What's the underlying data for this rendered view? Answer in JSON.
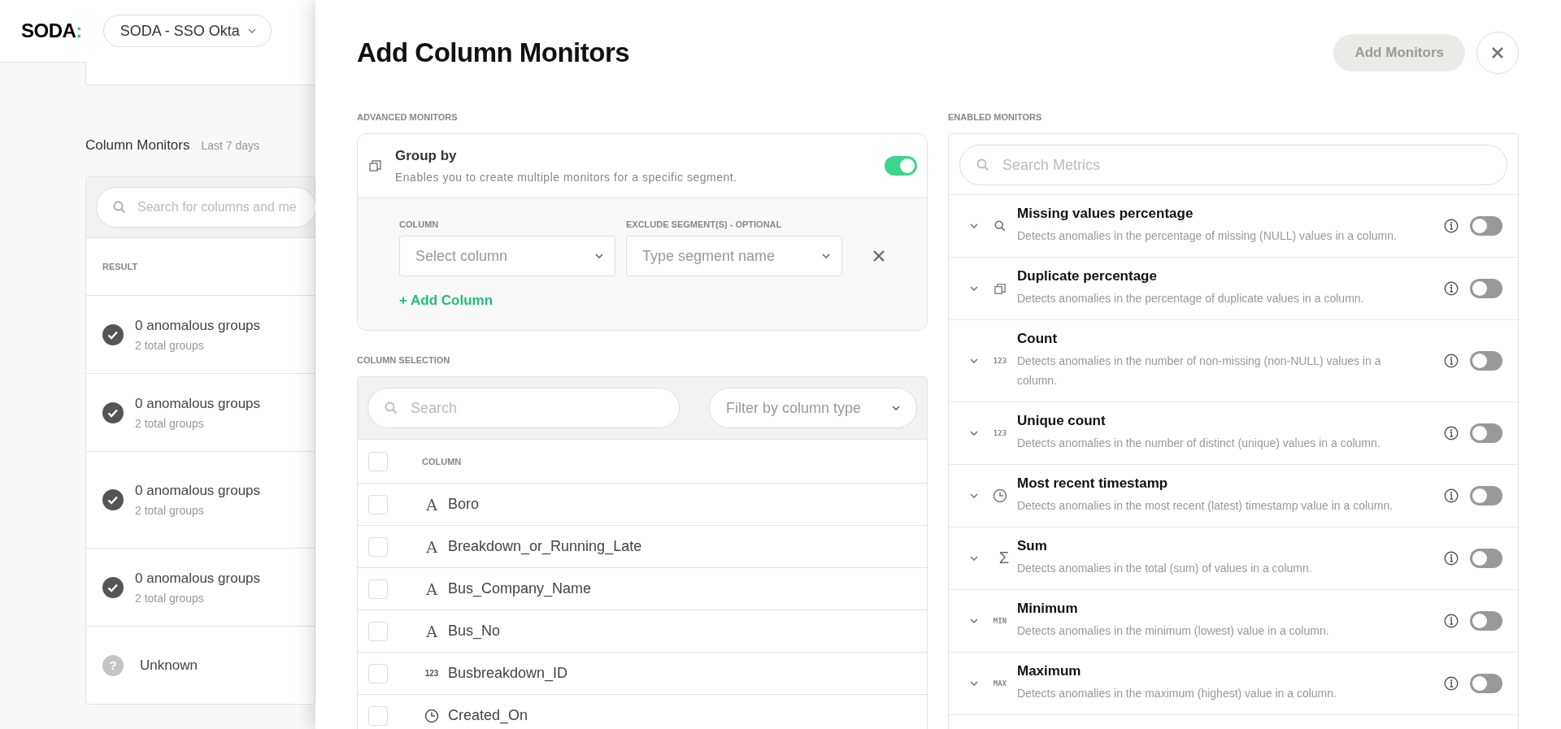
{
  "header": {
    "logo": "SODA",
    "logo_mark": ":",
    "org": "SODA - SSO Okta"
  },
  "background": {
    "section_title": "Column Monitors",
    "section_period": "Last 7 days",
    "search": {
      "placeholder": "Search for columns and me"
    },
    "column_header": "RESULT",
    "rows": [
      {
        "kind": "ok",
        "title": "0 anomalous groups",
        "subtitle": "2 total groups"
      },
      {
        "kind": "ok",
        "title": "0 anomalous groups",
        "subtitle": "2 total groups"
      },
      {
        "kind": "ok",
        "title": "0 anomalous groups",
        "subtitle": "2 total groups"
      },
      {
        "kind": "ok",
        "title": "0 anomalous groups",
        "subtitle": "2 total groups"
      },
      {
        "kind": "unknown",
        "status_glyph": "?",
        "title": "Unknown"
      }
    ]
  },
  "modal": {
    "title": "Add Column Monitors",
    "primary_button": {
      "label": "Add Monitors",
      "disabled": true
    },
    "advanced": {
      "heading": "ADVANCED MONITORS",
      "group_by": {
        "title": "Group by",
        "description": "Enables you to create multiple monitors for a specific segment.",
        "on": true,
        "column_label": "COLUMN",
        "column_select": {
          "placeholder": "Select column"
        },
        "exclude_label": "EXCLUDE SEGMENT(S) - OPTIONAL",
        "exclude_select": {
          "placeholder": "Type segment name"
        },
        "add_link": "+ Add Column"
      }
    },
    "column_selection": {
      "heading": "COLUMN SELECTION",
      "search": {
        "placeholder": "Search"
      },
      "filter": {
        "placeholder": "Filter by column type"
      },
      "column_header": "COLUMN",
      "all_checked": false,
      "rows": [
        {
          "kind": "text",
          "type_glyph": "A",
          "name": "Boro",
          "checked": false
        },
        {
          "kind": "text",
          "type_glyph": "A",
          "name": "Breakdown_or_Running_Late",
          "checked": false
        },
        {
          "kind": "text",
          "type_glyph": "A",
          "name": "Bus_Company_Name",
          "checked": false
        },
        {
          "kind": "text",
          "type_glyph": "A",
          "name": "Bus_No",
          "checked": false
        },
        {
          "kind": "number",
          "type_glyph": "123",
          "name": "Busbreakdown_ID",
          "checked": false
        },
        {
          "kind": "time",
          "name": "Created_On",
          "checked": false
        }
      ]
    },
    "enabled": {
      "heading": "ENABLED MONITORS",
      "search": {
        "placeholder": "Search Metrics"
      },
      "monitors": [
        {
          "kind": "search",
          "title": "Missing values percentage",
          "description": "Detects anomalies in the percentage of missing (NULL) values in a column.",
          "on": false
        },
        {
          "kind": "duplicate",
          "title": "Duplicate percentage",
          "description": "Detects anomalies in the percentage of duplicate values in a column.",
          "on": false
        },
        {
          "kind": "glyph",
          "glyph": "123",
          "title": "Count",
          "description": "Detects anomalies in the number of non-missing (non-NULL) values in a column.",
          "on": false
        },
        {
          "kind": "glyph",
          "glyph": "123",
          "title": "Unique count",
          "description": "Detects anomalies in the number of distinct (unique) values in a column.",
          "on": false
        },
        {
          "kind": "clock",
          "title": "Most recent timestamp",
          "description": "Detects anomalies in the most recent (latest) timestamp value in a column.",
          "on": false
        },
        {
          "kind": "sum",
          "glyph": "Σ",
          "title": "Sum",
          "description": "Detects anomalies in the total (sum) of values in a column.",
          "on": false
        },
        {
          "kind": "glyph",
          "glyph": "MIN",
          "title": "Minimum",
          "description": "Detects anomalies in the minimum (lowest) value in a column.",
          "on": false
        },
        {
          "kind": "glyph",
          "glyph": "MAX",
          "title": "Maximum",
          "description": "Detects anomalies in the maximum (highest) value in a column.",
          "on": false
        }
      ]
    }
  }
}
